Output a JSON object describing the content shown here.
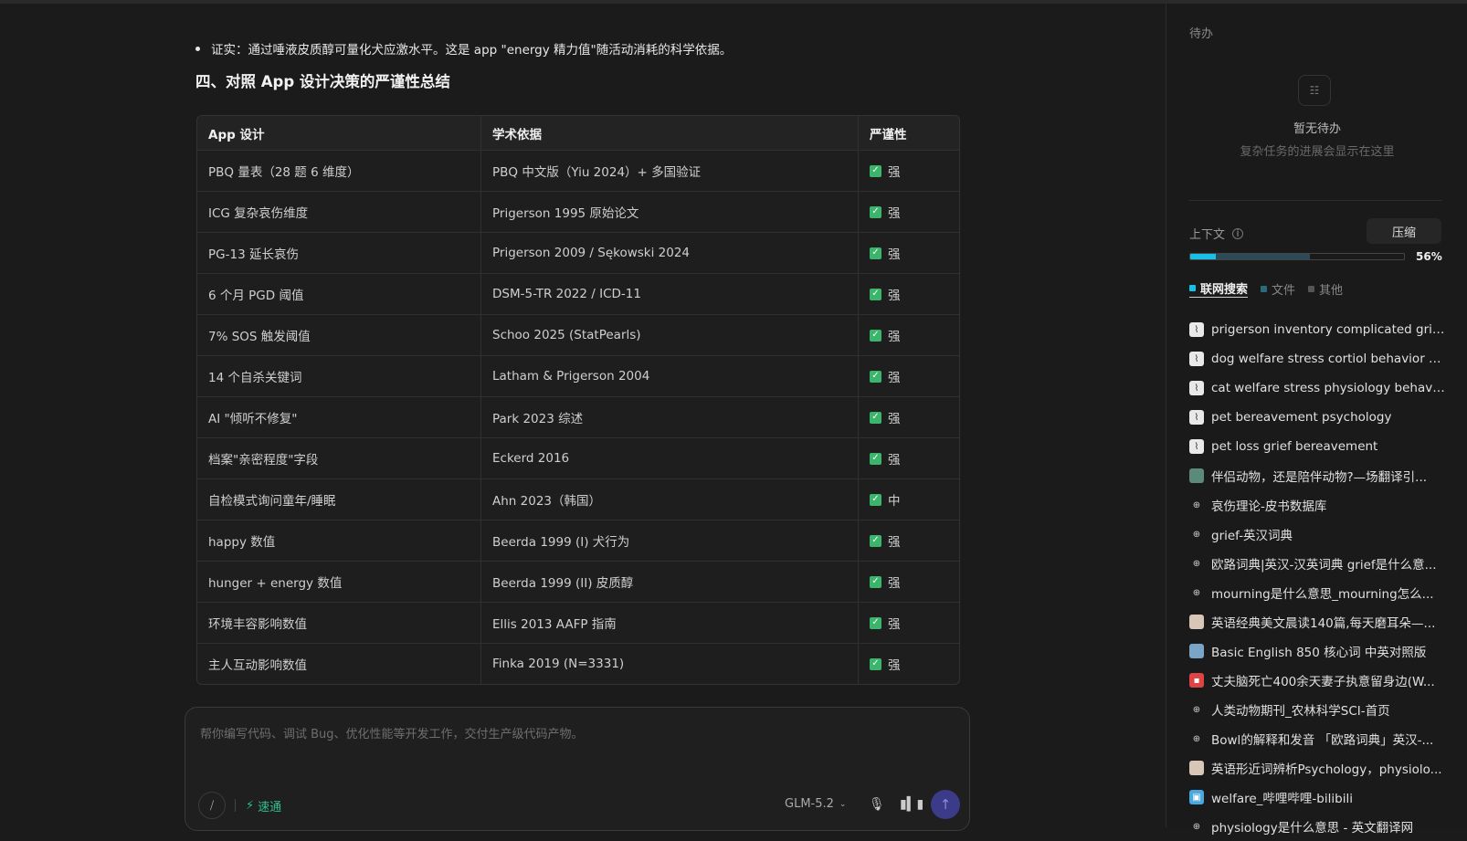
{
  "content": {
    "bullet": "证实：通过唾液皮质醇可量化犬应激水平。这是 app \"energy 精力值\"随活动消耗的科学依据。",
    "heading": "四、对照 App 设计决策的严谨性总结",
    "table": {
      "headers": [
        "App 设计",
        "学术依据",
        "严谨性"
      ],
      "rows": [
        [
          "PBQ 量表（28 题 6 维度）",
          "PBQ 中文版（Yiu 2024）+ 多国验证",
          "强"
        ],
        [
          "ICG 复杂哀伤维度",
          "Prigerson 1995 原始论文",
          "强"
        ],
        [
          "PG-13 延长哀伤",
          "Prigerson 2009 / Sękowski 2024",
          "强"
        ],
        [
          "6 个月 PGD 阈值",
          "DSM-5-TR 2022 / ICD-11",
          "强"
        ],
        [
          "7% SOS 触发阈值",
          "Schoo 2025 (StatPearls)",
          "强"
        ],
        [
          "14 个自杀关键词",
          "Latham & Prigerson 2004",
          "强"
        ],
        [
          "AI \"倾听不修复\"",
          "Park 2023 综述",
          "强"
        ],
        [
          "档案\"亲密程度\"字段",
          "Eckerd 2016",
          "强"
        ],
        [
          "自检模式询问童年/睡眠",
          "Ahn 2023（韩国）",
          "中"
        ],
        [
          "happy 数值",
          "Beerda 1999 (I) 犬行为",
          "强"
        ],
        [
          "hunger + energy 数值",
          "Beerda 1999 (II) 皮质醇",
          "强"
        ],
        [
          "环境丰容影响数值",
          "Ellis 2013 AAFP 指南",
          "强"
        ],
        [
          "主人互动影响数值",
          "Finka 2019 (N=3331)",
          "强"
        ]
      ]
    }
  },
  "composer": {
    "placeholder": "帮你编写代码、调试 Bug、优化性能等开发工作，交付生产级代码产物。",
    "speed_label": "速通",
    "model": "GLM-5.2"
  },
  "sidebar": {
    "title": "待办",
    "todo_empty": "暂无待办",
    "todo_hint": "复杂任务的进展会显示在这里",
    "context_label": "上下文",
    "compress_label": "压缩",
    "context_percent": "56%",
    "context_usage": {
      "web": 0.12,
      "files": 0.44
    },
    "colors": {
      "web": "#18bfe6",
      "files": "#2c4a58",
      "other": "#555555"
    },
    "legend": [
      "联网搜索",
      "文件",
      "其他"
    ],
    "sources": [
      {
        "icon": "image-icon",
        "text": "prigerson inventory complicated grief ..."
      },
      {
        "icon": "image-icon",
        "text": "dog welfare stress cortiol behavior ph..."
      },
      {
        "icon": "image-icon",
        "text": "cat welfare stress physiology behavior"
      },
      {
        "icon": "image-icon",
        "text": "pet bereavement psychology"
      },
      {
        "icon": "image-icon",
        "text": "pet loss grief bereavement"
      },
      {
        "icon": "photo-icon",
        "text": "伴侣动物，还是陪伴动物?—场翻译引..."
      },
      {
        "icon": "globe-icon",
        "text": "哀伤理论-皮书数据库"
      },
      {
        "icon": "globe-icon",
        "text": "grief-英汉词典"
      },
      {
        "icon": "globe-icon",
        "text": "欧路词典|英汉-汉英词典 grief是什么意..."
      },
      {
        "icon": "globe-icon",
        "text": "mourning是什么意思_mourning怎么..."
      },
      {
        "icon": "face-icon",
        "text": "英语经典美文晨读140篇,每天磨耳朵—..."
      },
      {
        "icon": "blue-icon",
        "text": "Basic English 850 核心词 中英对照版"
      },
      {
        "icon": "red-icon",
        "text": "丈夫脑死亡400余天妻子执意留身边(W..."
      },
      {
        "icon": "globe-icon",
        "text": "人类动物期刊_农林科学SCI-首页"
      },
      {
        "icon": "globe-icon",
        "text": "Bowl的解释和发音 「欧路词典」英汉-..."
      },
      {
        "icon": "face-icon",
        "text": "英语形近词辨析Psychology，physiolo..."
      },
      {
        "icon": "bili-icon",
        "text": "welfare_哔哩哔哩-bilibili"
      },
      {
        "icon": "globe-icon",
        "text": "physiology是什么意思 - 英文翻译网"
      }
    ]
  }
}
